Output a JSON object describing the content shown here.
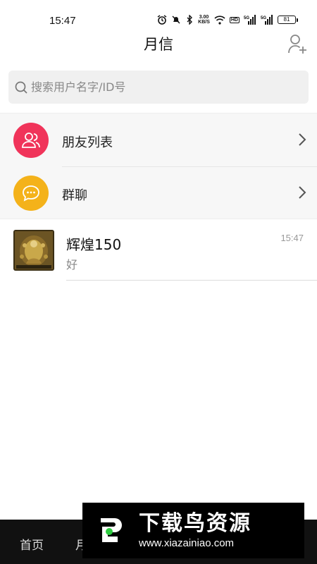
{
  "status_bar": {
    "time": "15:47",
    "speed_value": "3.00",
    "speed_unit": "KB/S",
    "hd_label": "HD",
    "signal1": "5G",
    "signal2": "5G",
    "battery": "81"
  },
  "header": {
    "title": "月信"
  },
  "search": {
    "placeholder": "搜索用户名字/ID号"
  },
  "menu": {
    "friends_label": "朋友列表",
    "friends_color": "#f0345a",
    "group_label": "群聊",
    "group_color": "#f4b21a"
  },
  "chats": [
    {
      "name": "辉煌150",
      "message": "好",
      "time": "15:47"
    }
  ],
  "bottom_tabs": {
    "home": "首页",
    "second_partial": "月"
  },
  "watermark": {
    "title": "下载鸟资源",
    "url": "www.xiazainiao.com"
  }
}
